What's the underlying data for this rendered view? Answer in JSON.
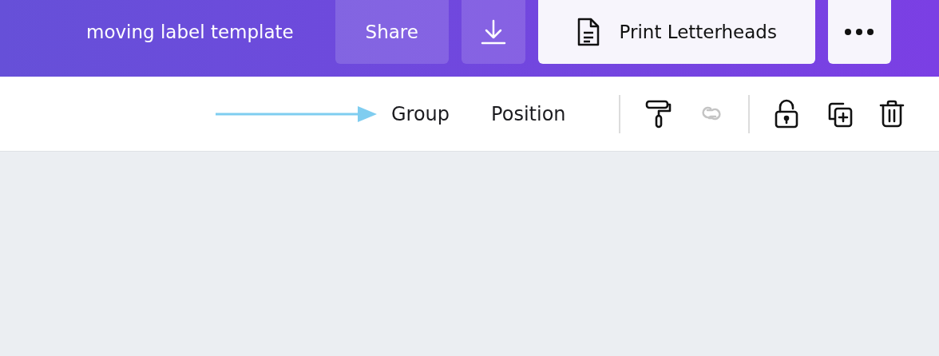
{
  "header": {
    "title": "moving label template",
    "share_button": "Share",
    "print_button": "Print Letterheads"
  },
  "toolbar": {
    "text_buttons": [
      "Group",
      "Position"
    ],
    "icon_groups": [
      [
        {
          "disabled": false
        },
        {
          "disabled": true
        }
      ],
      [
        {
          "disabled": false
        },
        {
          "disabled": false
        },
        {
          "disabled": false
        }
      ]
    ]
  }
}
